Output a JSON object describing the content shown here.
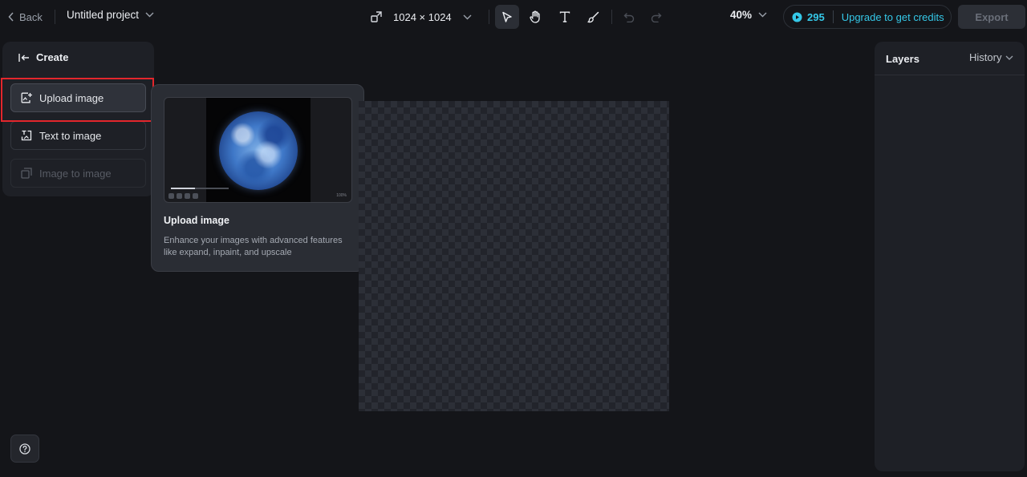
{
  "topbar": {
    "back_label": "Back",
    "project_name": "Untitled project",
    "canvas_size": "1024 × 1024",
    "zoom": "40%",
    "credits_count": "295",
    "upgrade_label": "Upgrade to get credits",
    "export_label": "Export",
    "tools": [
      {
        "name": "select-icon",
        "active": true
      },
      {
        "name": "hand-icon",
        "active": false
      },
      {
        "name": "text-icon",
        "active": false
      },
      {
        "name": "brush-icon",
        "active": false
      },
      {
        "name": "undo-icon",
        "active": false
      },
      {
        "name": "redo-icon",
        "active": false
      }
    ]
  },
  "left_panel": {
    "header": "Create",
    "items": [
      {
        "label": "Upload image",
        "icon": "upload-image-icon",
        "state": "selected"
      },
      {
        "label": "Text to image",
        "icon": "text-to-image-icon",
        "state": "normal"
      },
      {
        "label": "Image to image",
        "icon": "image-to-image-icon",
        "state": "disabled"
      }
    ]
  },
  "tooltip": {
    "title": "Upload image",
    "description": "Enhance your images with advanced features like expand, inpaint, and upscale",
    "preview_zoom_text": "100%"
  },
  "right_panel": {
    "layers_label": "Layers",
    "history_label": "History"
  },
  "help": {
    "icon": "help-icon"
  },
  "colors": {
    "background": "#141519",
    "panel": "#1e2026",
    "accent": "#35c8e8",
    "highlight": "#e3262c"
  }
}
